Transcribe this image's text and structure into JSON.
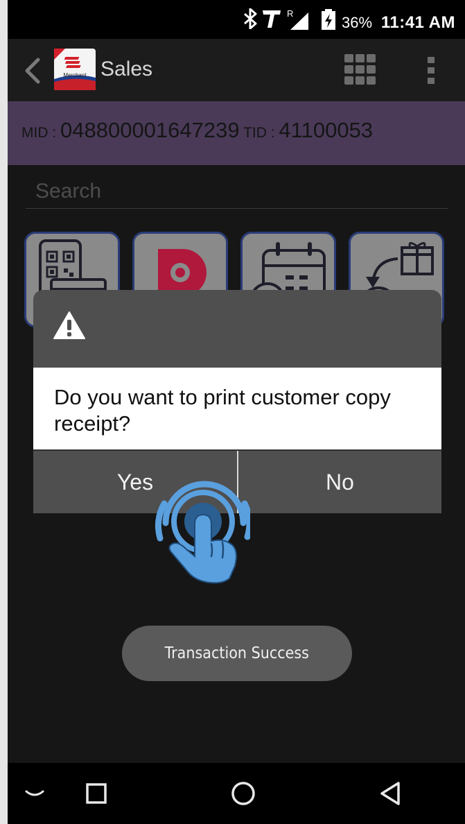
{
  "status_bar": {
    "battery": "36%",
    "time": "11:41 AM",
    "icons": [
      "bluetooth-icon",
      "carrier-t-icon",
      "signal-roaming-icon",
      "battery-charging-icon"
    ]
  },
  "app_bar": {
    "title": "Sales",
    "logo_label": "Merchant",
    "icons": [
      "back-arrow-icon",
      "merchant-logo-icon",
      "grid-menu-icon",
      "more-vertical-icon"
    ]
  },
  "merchant_info": {
    "mid_label": "MID : ",
    "mid_value": "048800001647239",
    "tid_label": " TID : ",
    "tid_value": "41100053"
  },
  "search": {
    "placeholder": "Search"
  },
  "tiles": [
    "qr-payment-icon",
    "brand-d-logo-icon",
    "calendar-clock-icon",
    "gift-return-icon"
  ],
  "dialog": {
    "icon": "warning-icon",
    "message": "Do you want to print customer copy receipt?",
    "yes_label": "Yes",
    "no_label": "No"
  },
  "toast": {
    "message": "Transaction Success"
  },
  "nav_bar": {
    "icons": [
      "keyboard-hide-icon",
      "recents-square-icon",
      "home-circle-icon",
      "back-triangle-icon"
    ]
  },
  "colors": {
    "purple_bar": "#4a3a58",
    "tile_border": "#2a3c78",
    "hand_blue": "#5a9fde",
    "dialog_gray": "#4f4f4f"
  }
}
